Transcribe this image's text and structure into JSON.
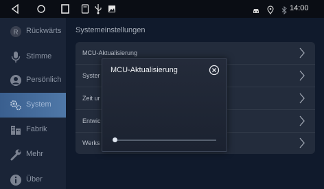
{
  "statusbar": {
    "time": "14:00",
    "icons": [
      "back-icon",
      "home-icon",
      "recent-apps-icon",
      "screenshot-icon",
      "usb-icon",
      "image-icon",
      "car-icon",
      "location-icon",
      "bluetooth-icon"
    ]
  },
  "sidebar": {
    "items": [
      {
        "label": "Rückwärts",
        "icon": "reverse-icon"
      },
      {
        "label": "Stimme",
        "icon": "microphone-icon"
      },
      {
        "label": "Persönlich",
        "icon": "person-icon"
      },
      {
        "label": "System",
        "icon": "gear-icon",
        "active": true
      },
      {
        "label": "Fabrik",
        "icon": "factory-icon"
      },
      {
        "label": "Mehr",
        "icon": "wrench-icon"
      },
      {
        "label": "Über",
        "icon": "info-icon"
      }
    ]
  },
  "main": {
    "title": "Systemeinstellungen",
    "rows": [
      {
        "label": "MCU-Aktualisierung"
      },
      {
        "label": "Syster"
      },
      {
        "label": "Zeit ur"
      },
      {
        "label": "Entwic"
      },
      {
        "label": "Werks"
      }
    ]
  },
  "dialog": {
    "title": "MCU-Aktualisierung",
    "progress": 0.0
  },
  "colors": {
    "active_sidebar": "#4f78a8",
    "background": "#101a2c",
    "panel": "#232c3c"
  }
}
